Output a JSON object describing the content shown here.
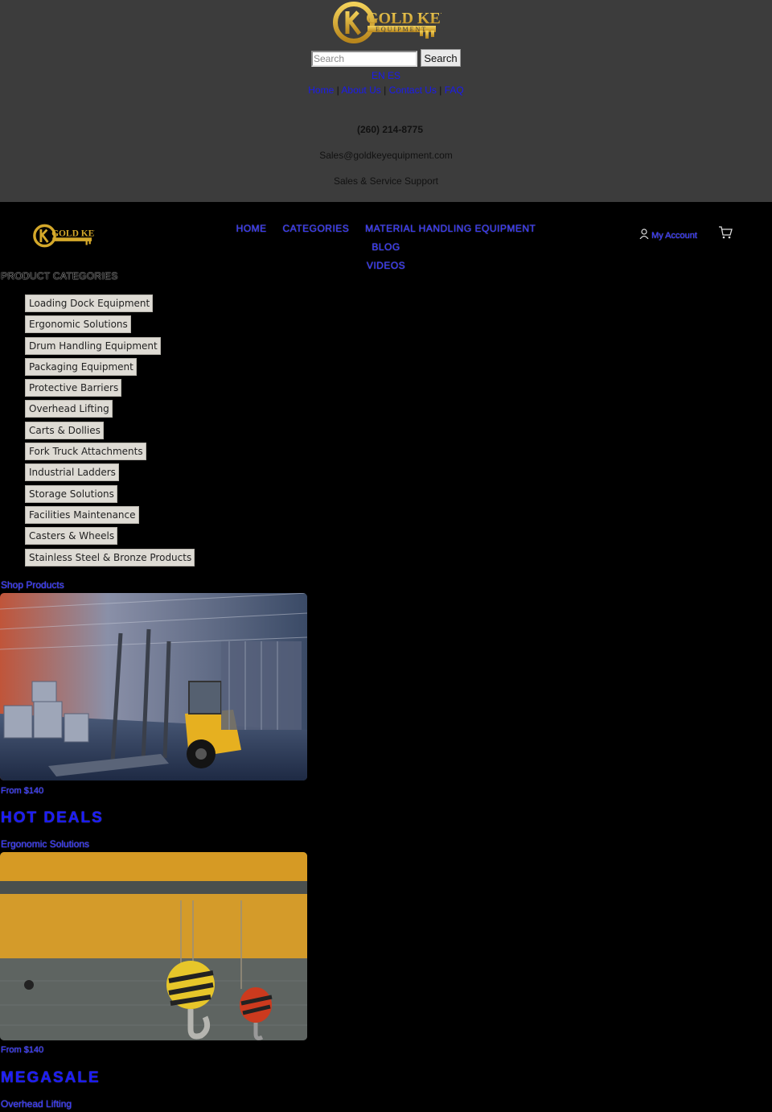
{
  "header": {
    "brand": "GOLD KEY",
    "brand_sub": "EQUIPMENT",
    "search": {
      "placeholder": "Search",
      "button": "Search"
    },
    "languages": [
      "EN",
      "ES"
    ],
    "top_links": [
      "Home",
      "About Us",
      "Contact Us",
      "FAQ"
    ],
    "phone": "(260) 214-8775",
    "email": "Sales@goldkeyequipment.com",
    "support": "Sales & Service Support"
  },
  "nav": {
    "items": [
      "HOME",
      "CATEGORIES",
      "MATERIAL HANDLING EQUIPMENT",
      "BLOG",
      "VIDEOS"
    ],
    "account": "My Account"
  },
  "categories": {
    "heading": "PRODUCT CATEGORIES",
    "items": [
      "Loading Dock Equipment",
      "Ergonomic Solutions",
      "Drum Handling Equipment",
      "Packaging Equipment",
      "Protective Barriers",
      "Overhead Lifting",
      "Carts & Dollies",
      "Fork Truck Attachments",
      "Industrial Ladders",
      "Storage Solutions",
      "Facilities Maintenance",
      "Casters & Wheels",
      "Stainless Steel & Bronze Products"
    ]
  },
  "promos": [
    {
      "top_link": "Shop Products",
      "price": "From $140",
      "title": "HOT DEALS",
      "category": "Ergonomic Solutions"
    },
    {
      "price": "From $140",
      "title": "MEGASALE",
      "category": "Overhead Lifting"
    }
  ],
  "colors": {
    "top_bar": "#3c3c3c",
    "page_bg": "#000000",
    "link_blue": "#1a1af0",
    "gold": "#d4a82a"
  },
  "icons": [
    "user-icon",
    "cart-icon"
  ]
}
